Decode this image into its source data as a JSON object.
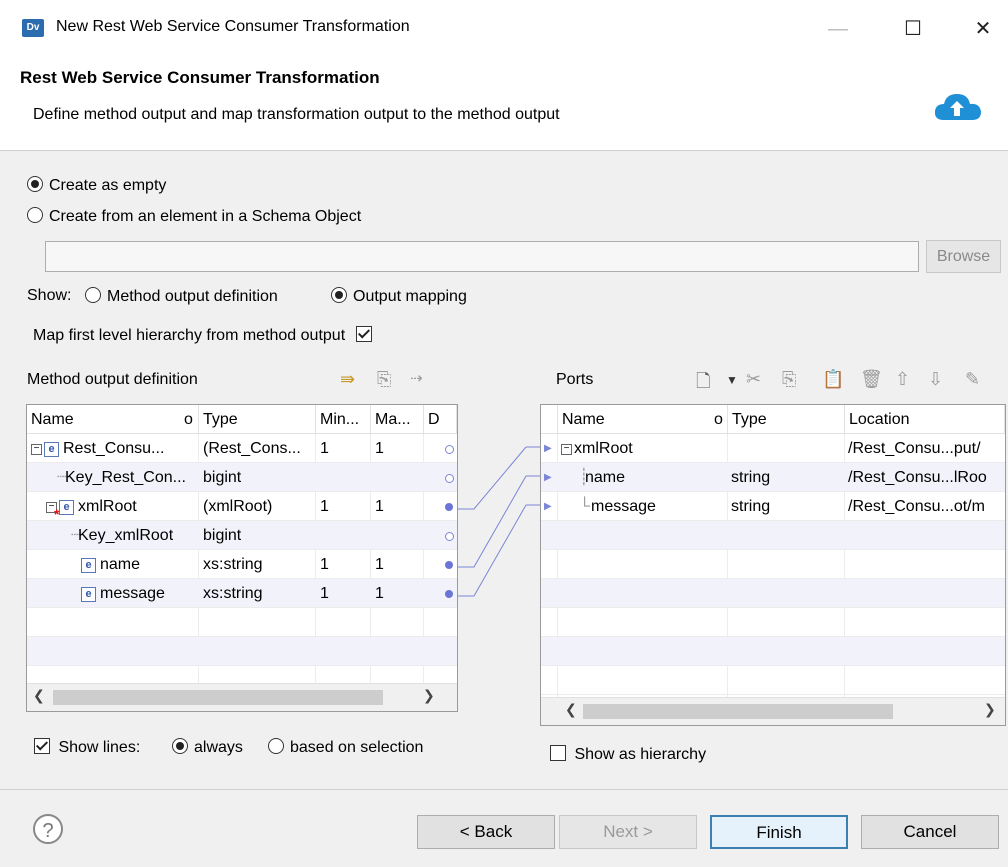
{
  "window": {
    "app_icon": "Dv",
    "title": "New Rest Web Service Consumer Transformation",
    "minimize": "—",
    "maximize": "☐",
    "close": "✕"
  },
  "header": {
    "title": "Rest Web Service Consumer Transformation",
    "description": "Define method output and map transformation output to the method output",
    "icon": "cloud-icon"
  },
  "create": {
    "empty_label": "Create as empty",
    "from_schema_label": "Create from an element in a Schema Object",
    "schema_value": "",
    "browse_label": "Browse",
    "selected": "empty"
  },
  "show": {
    "label": "Show:",
    "method_output_def": "Method output definition",
    "output_mapping": "Output mapping",
    "selected": "output_mapping"
  },
  "map_first_level": {
    "label": "Map first level hierarchy from method output",
    "checked": true
  },
  "left_panel": {
    "title": "Method output definition",
    "columns": [
      "Name",
      "o",
      "Type",
      "Min...",
      "Ma...",
      "D"
    ],
    "rows": [
      {
        "name": "Rest_Consu...",
        "type": "(Rest_Cons...",
        "min": "1",
        "max": "1"
      },
      {
        "name": "Key_Rest_Con...",
        "type": "bigint",
        "min": "",
        "max": ""
      },
      {
        "name": "xmlRoot",
        "type": "(xmlRoot)",
        "min": "1",
        "max": "1"
      },
      {
        "name": "Key_xmlRoot",
        "type": "bigint",
        "min": "",
        "max": ""
      },
      {
        "name": "name",
        "type": "xs:string",
        "min": "1",
        "max": "1"
      },
      {
        "name": "message",
        "type": "xs:string",
        "min": "1",
        "max": "1"
      }
    ]
  },
  "right_panel": {
    "title": "Ports",
    "columns": [
      "Name",
      "o",
      "Type",
      "Location"
    ],
    "rows": [
      {
        "name": "xmlRoot",
        "type": "",
        "location": "/Rest_Consu...put/"
      },
      {
        "name": "name",
        "type": "string",
        "location": "/Rest_Consu...lRoo"
      },
      {
        "name": "message",
        "type": "string",
        "location": "/Rest_Consu...ot/m"
      }
    ]
  },
  "show_lines": {
    "label": "Show lines:",
    "always": "always",
    "based_on_selection": "based on selection",
    "checked": true,
    "selected": "always"
  },
  "show_as_hierarchy": {
    "label": "Show as hierarchy",
    "checked": false
  },
  "buttons": {
    "back": "< Back",
    "next": "Next >",
    "finish": "Finish",
    "cancel": "Cancel",
    "help": "?"
  }
}
